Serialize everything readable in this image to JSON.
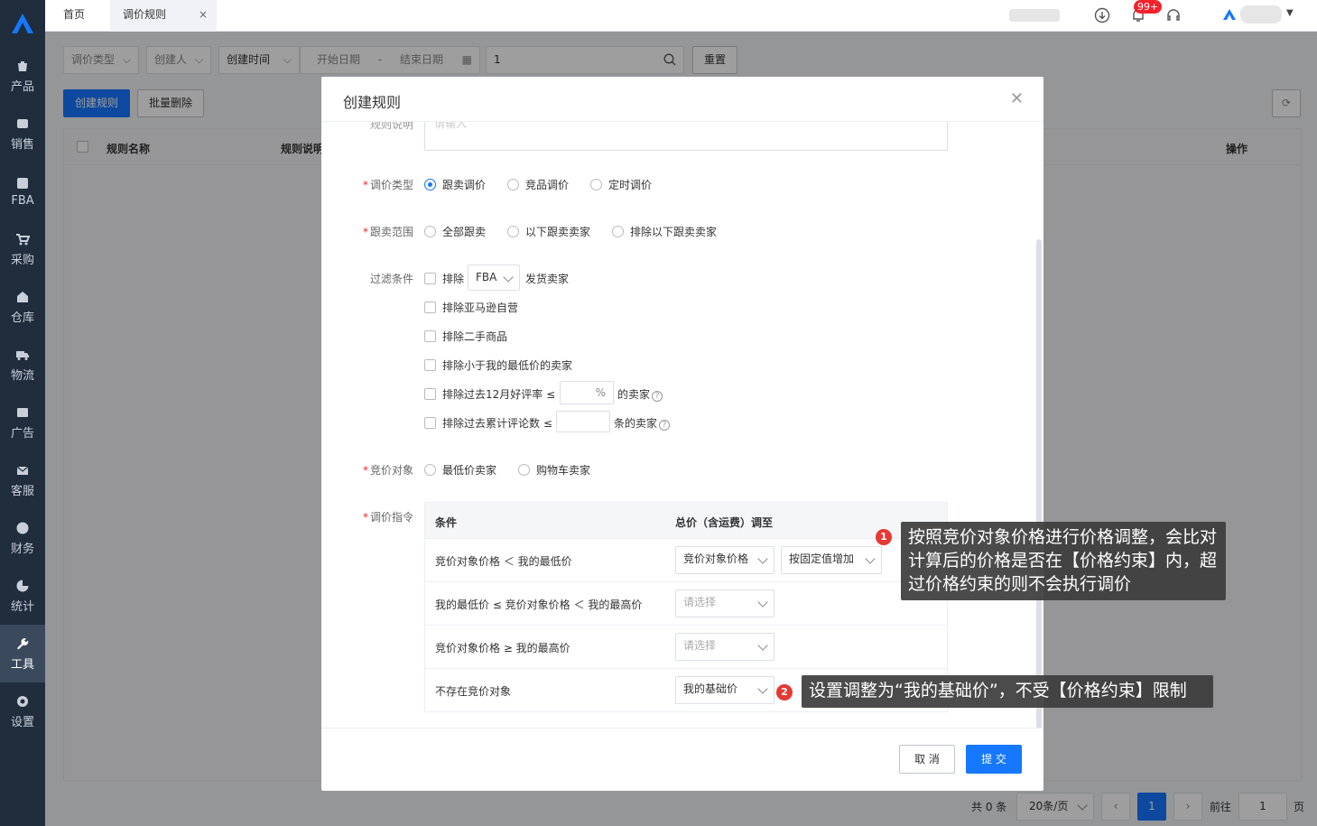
{
  "sidebar": {
    "items": [
      {
        "label": "产品",
        "icon": "bag-icon"
      },
      {
        "label": "销售",
        "icon": "sell-icon"
      },
      {
        "label": "FBA",
        "icon": "amazon-icon"
      },
      {
        "label": "采购",
        "icon": "cart-icon"
      },
      {
        "label": "仓库",
        "icon": "warehouse-icon"
      },
      {
        "label": "物流",
        "icon": "truck-icon"
      },
      {
        "label": "广告",
        "icon": "ad-icon"
      },
      {
        "label": "客服",
        "icon": "mail-icon"
      },
      {
        "label": "财务",
        "icon": "yen-icon"
      },
      {
        "label": "统计",
        "icon": "pie-icon"
      },
      {
        "label": "工具",
        "icon": "wrench-icon"
      },
      {
        "label": "设置",
        "icon": "gear-icon"
      }
    ],
    "active": "工具"
  },
  "topbar": {
    "tabs": [
      {
        "label": "首页"
      },
      {
        "label": "调价规则"
      }
    ],
    "notification_count": "99+"
  },
  "filters": {
    "type": "调价类型",
    "creator": "创建人",
    "time": "创建时间",
    "start_date": "开始日期",
    "date_sep": "-",
    "end_date": "结束日期",
    "search_value": "1",
    "reset": "重置"
  },
  "actions": {
    "create": "创建规则",
    "batch_delete": "批量删除"
  },
  "table": {
    "col_name": "规则名称",
    "col_desc": "规则说明",
    "col_ops": "操作"
  },
  "pager": {
    "total": "共 0 条",
    "page_size": "20条/页",
    "current": "1",
    "goto": "前往",
    "goto_value": "1",
    "page_unit": "页"
  },
  "modal": {
    "title": "创建规则",
    "desc_label": "规则说明",
    "desc_placeholder": "请输入",
    "price_type": {
      "label": "调价类型",
      "options": [
        "跟卖调价",
        "竞品调价",
        "定时调价"
      ],
      "selected": 0
    },
    "scope": {
      "label": "跟卖范围",
      "options": [
        "全部跟卖",
        "以下跟卖卖家",
        "排除以下跟卖卖家"
      ]
    },
    "filter": {
      "label": "过滤条件",
      "exclude": "排除",
      "fba": "FBA",
      "ship_seller": "发货卖家",
      "amazon": "排除亚马逊自营",
      "used": "排除二手商品",
      "below_min": "排除小于我的最低价的卖家",
      "rating": "排除过去12月好评率 ≤",
      "percent": "%",
      "rating_suffix": "的卖家",
      "reviews": "排除过去累计评论数 ≤",
      "reviews_suffix": "条的卖家"
    },
    "competitor": {
      "label": "竞价对象",
      "options": [
        "最低价卖家",
        "购物车卖家"
      ]
    },
    "command": {
      "label": "调价指令",
      "head_cond": "条件",
      "head_price": "总价（含运费）调至",
      "rows": [
        {
          "cond": "竞价对象价格 ＜ 我的最低价",
          "sel1": "竞价对象价格",
          "sel2": "按固定值增加"
        },
        {
          "cond": "我的最低价 ≤ 竞价对象价格 ＜ 我的最高价",
          "sel1": "请选择"
        },
        {
          "cond": "竞价对象价格 ≥ 我的最高价",
          "sel1": "请选择"
        },
        {
          "cond": "不存在竞价对象",
          "sel1": "我的基础价"
        }
      ]
    },
    "cancel": "取 消",
    "submit": "提 交"
  },
  "tips": [
    {
      "num": "1",
      "text": "按照竞价对象价格进行价格调整，会比对计算后的价格是否在【价格约束】内，超过价格约束的则不会执行调价"
    },
    {
      "num": "2",
      "text": "设置调整为“我的基础价”，不受【价格约束】限制"
    }
  ]
}
